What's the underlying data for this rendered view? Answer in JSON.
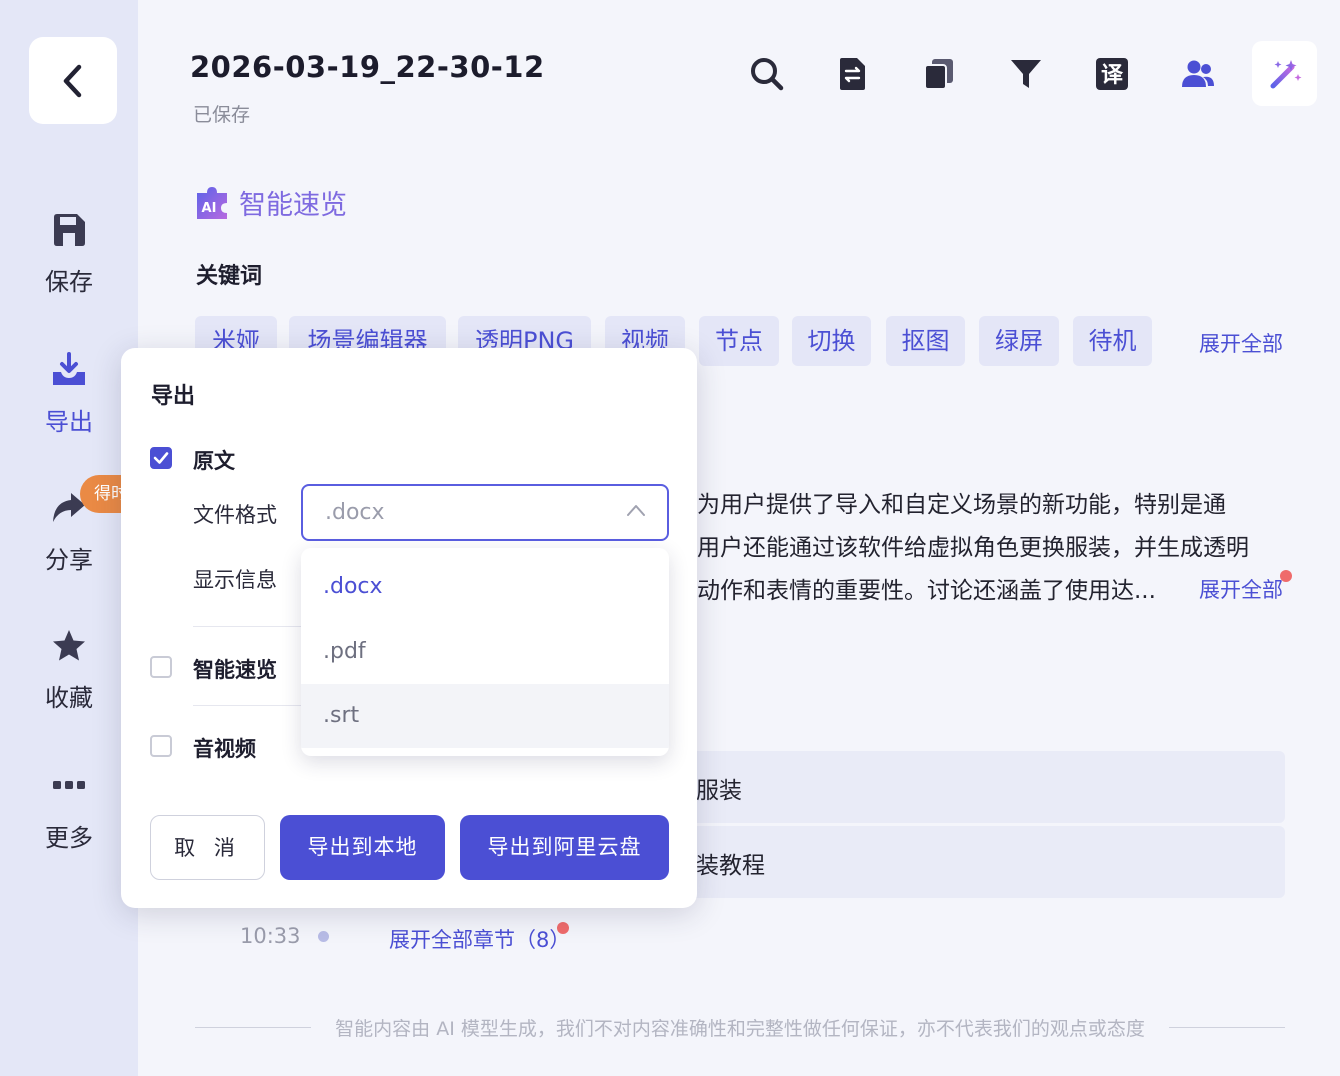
{
  "header": {
    "title": "2026-03-19_22-30-12",
    "status": "已保存"
  },
  "sidebar": {
    "items": [
      {
        "label": "保存",
        "icon": "save-icon"
      },
      {
        "label": "导出",
        "icon": "export-icon"
      },
      {
        "label": "分享",
        "icon": "share-icon"
      },
      {
        "label": "收藏",
        "icon": "star-icon"
      },
      {
        "label": "更多",
        "icon": "more-icon"
      }
    ],
    "share_badge": "得时"
  },
  "toolbar": {
    "icons": [
      "search-icon",
      "file-swap-icon",
      "copy-icon",
      "filter-icon",
      "translate-icon",
      "users-icon",
      "magic-wand-icon"
    ],
    "translate_glyph": "译"
  },
  "content": {
    "ai_badge": "AI",
    "ai_title": "智能速览",
    "keywords_heading": "关键词",
    "keywords": [
      "米娅",
      "场景编辑器",
      "透明PNG",
      "视频",
      "节点",
      "切换",
      "抠图",
      "绿屏",
      "待机"
    ],
    "keywords_expand": "展开全部",
    "summary_lines": [
      "为用户提供了导入和自定义场景的新功能，特别是通",
      "用户还能通过该软件给虚拟角色更换服装，并生成透明",
      "动作和表情的重要性。讨论还涵盖了使用达..."
    ],
    "summary_expand": "展开全部",
    "chapters": [
      "服装",
      "装教程"
    ],
    "last_time": "10:33",
    "chapters_expand": "展开全部章节（8）",
    "disclaimer": "智能内容由 AI 模型生成，我们不对内容准确性和完整性做任何保证，亦不代表我们的观点或态度"
  },
  "export_modal": {
    "title": "导出",
    "original_label": "原文",
    "original_checked": true,
    "file_format_label": "文件格式",
    "file_format_value": ".docx",
    "display_info_label": "显示信息",
    "smart_summary_label": "智能速览",
    "smart_summary_checked": false,
    "av_label": "音视频",
    "av_checked": false,
    "cancel_label": "取 消",
    "export_local_label": "导出到本地",
    "export_cloud_label": "导出到阿里云盘",
    "format_options": [
      ".docx",
      ".pdf",
      ".srt"
    ],
    "selected_option": ".docx",
    "hover_option": ".srt"
  },
  "colors": {
    "accent": "#4b4fd4",
    "badge_orange": "#ea8a45",
    "sidebar_bg": "#e4e7f7",
    "page_bg": "#f4f5fb",
    "tag_bg": "#e4e6f7",
    "notify_red": "#ef6b6b"
  }
}
